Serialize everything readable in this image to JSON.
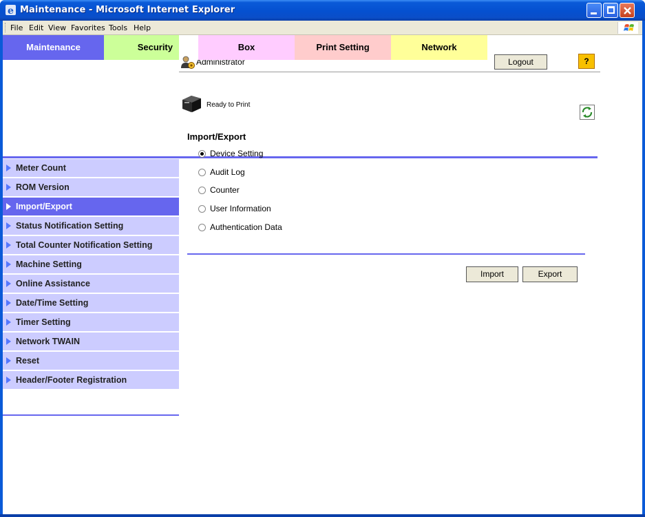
{
  "window": {
    "title": "Maintenance - Microsoft Internet Explorer"
  },
  "menu": [
    "File",
    "Edit",
    "View",
    "Favorites",
    "Tools",
    "Help"
  ],
  "header": {
    "user_label": "Administrator",
    "logout_label": "Logout",
    "help_label": "?",
    "status_text": "Ready to Print"
  },
  "tabs": [
    {
      "label": "Maintenance",
      "color": "#6666ee",
      "text_color": "#ffffff"
    },
    {
      "label": "Security",
      "color": "#ccff99",
      "text_color": "#000000"
    },
    {
      "label": "Box",
      "color": "#ffccff",
      "text_color": "#000000"
    },
    {
      "label": "Print Setting",
      "color": "#ffcccc",
      "text_color": "#000000"
    },
    {
      "label": "Network",
      "color": "#ffff99",
      "text_color": "#000000"
    }
  ],
  "sidebar": {
    "items": [
      {
        "label": "Meter Count"
      },
      {
        "label": "ROM Version"
      },
      {
        "label": "Import/Export",
        "active": true
      },
      {
        "label": "Status Notification Setting"
      },
      {
        "label": "Total Counter Notification Setting"
      },
      {
        "label": "Machine Setting"
      },
      {
        "label": "Online Assistance"
      },
      {
        "label": "Date/Time Setting"
      },
      {
        "label": "Timer Setting"
      },
      {
        "label": "Network TWAIN"
      },
      {
        "label": "Reset"
      },
      {
        "label": "Header/Footer Registration"
      }
    ]
  },
  "main": {
    "title": "Import/Export",
    "options": [
      {
        "label": "Device Setting",
        "checked": true
      },
      {
        "label": "Audit Log",
        "checked": false
      },
      {
        "label": "Counter",
        "checked": false
      },
      {
        "label": "User Information",
        "checked": false
      },
      {
        "label": "Authentication Data",
        "checked": false
      }
    ],
    "import_label": "Import",
    "export_label": "Export"
  },
  "icons": {
    "user": "admin-user-icon",
    "printer": "printer-icon",
    "refresh": "refresh-icon",
    "help": "help-icon"
  }
}
